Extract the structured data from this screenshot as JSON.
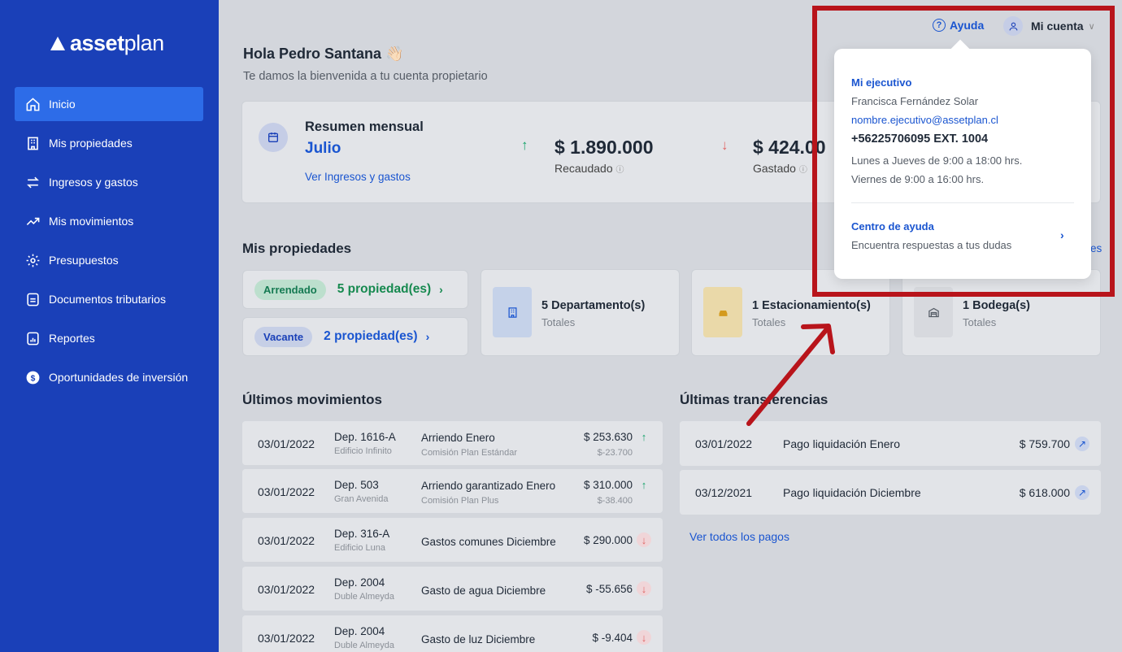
{
  "logo": {
    "bold": "asset",
    "light": "plan"
  },
  "sidebar": {
    "items": [
      {
        "label": "Inicio",
        "icon": "home-icon",
        "active": true
      },
      {
        "label": "Mis propiedades",
        "icon": "building-icon"
      },
      {
        "label": "Ingresos y gastos",
        "icon": "swap-icon"
      },
      {
        "label": "Mis movimientos",
        "icon": "trend-icon"
      },
      {
        "label": "Presupuestos",
        "icon": "gear-icon"
      },
      {
        "label": "Documentos tributarios",
        "icon": "document-icon"
      },
      {
        "label": "Reportes",
        "icon": "report-icon"
      },
      {
        "label": "Oportunidades de inversión",
        "icon": "dollar-icon"
      }
    ]
  },
  "header": {
    "help": "Ayuda",
    "account": "Mi cuenta"
  },
  "greeting": {
    "title": "Hola Pedro Santana 👋🏻",
    "subtitle": "Te damos la bienvenida a tu cuenta propietario"
  },
  "summary": {
    "title": "Resumen mensual",
    "month": "Julio",
    "link": "Ver Ingresos y gastos",
    "collected": {
      "amount": "$ 1.890.000",
      "label": "Recaudado"
    },
    "spent": {
      "amount": "$ 424.00",
      "label": "Gastado"
    }
  },
  "properties": {
    "title": "Mis propiedades",
    "rented": {
      "pill": "Arrendado",
      "count": "5 propiedad(es)"
    },
    "vacant": {
      "pill": "Vacante",
      "count": "2 propiedad(es)"
    },
    "types": [
      {
        "name": "5 Departamento(s)",
        "sub": "Totales",
        "icon": "building-icon",
        "bg": "#c5d2e9",
        "color": "#1a55d0"
      },
      {
        "name": "1 Estacionamiento(s)",
        "sub": "Totales",
        "icon": "car-icon",
        "bg": "#ead9a9",
        "color": "#d49b1e"
      },
      {
        "name": "1 Bodega(s)",
        "sub": "Totales",
        "icon": "warehouse-icon",
        "bg": "#d7d9de",
        "color": "#555c66"
      }
    ],
    "side_link": "es"
  },
  "movements": {
    "title": "Últimos movimientos",
    "rows": [
      {
        "date": "03/01/2022",
        "dep": "Dep. 1616-A",
        "building": "Edificio Infinito",
        "desc": "Arriendo Enero",
        "sub": "Comisión Plan Estándar",
        "amount": "$ 253.630",
        "amount2": "$-23.700",
        "dir": "↑"
      },
      {
        "date": "03/01/2022",
        "dep": "Dep. 503",
        "building": "Gran Avenida",
        "desc": "Arriendo garantizado Enero",
        "sub": "Comisión Plan Plus",
        "amount": "$ 310.000",
        "amount2": "$-38.400",
        "dir": "↑"
      },
      {
        "date": "03/01/2022",
        "dep": "Dep. 316-A",
        "building": "Edificio Luna",
        "desc": "Gastos comunes Diciembre",
        "sub": "",
        "amount": "$ 290.000",
        "amount2": "",
        "dir": "↓"
      },
      {
        "date": "03/01/2022",
        "dep": "Dep. 2004",
        "building": "Duble Almeyda",
        "desc": "Gasto de agua Diciembre",
        "sub": "",
        "amount": "$ -55.656",
        "amount2": "",
        "dir": "↓"
      },
      {
        "date": "03/01/2022",
        "dep": "Dep. 2004",
        "building": "Duble Almeyda",
        "desc": "Gasto de luz Diciembre",
        "sub": "",
        "amount": "$ -9.404",
        "amount2": "",
        "dir": "↓"
      }
    ]
  },
  "transfers": {
    "title": "Últimas transferencias",
    "rows": [
      {
        "date": "03/01/2022",
        "desc": "Pago liquidación Enero",
        "amount": "$ 759.700"
      },
      {
        "date": "03/12/2021",
        "desc": "Pago liquidación Diciembre",
        "amount": "$ 618.000"
      }
    ],
    "link": "Ver todos los pagos"
  },
  "popover": {
    "title": "Mi ejecutivo",
    "name": "Francisca Fernández Solar",
    "email": "nombre.ejecutivo@assetplan.cl",
    "phone": "+56225706095 EXT. 1004",
    "hours1": "Lunes a Jueves de 9:00 a 18:00 hrs.",
    "hours2": "Viernes de 9:00 a 16:00 hrs.",
    "help_title": "Centro de ayuda",
    "help_sub": "Encuentra respuestas a tus dudas"
  },
  "colors": {
    "primary": "#1a40b8",
    "accent": "#1a55d0",
    "highlight": "#b8141b",
    "positive": "#16a36a",
    "negative": "#e06666"
  }
}
